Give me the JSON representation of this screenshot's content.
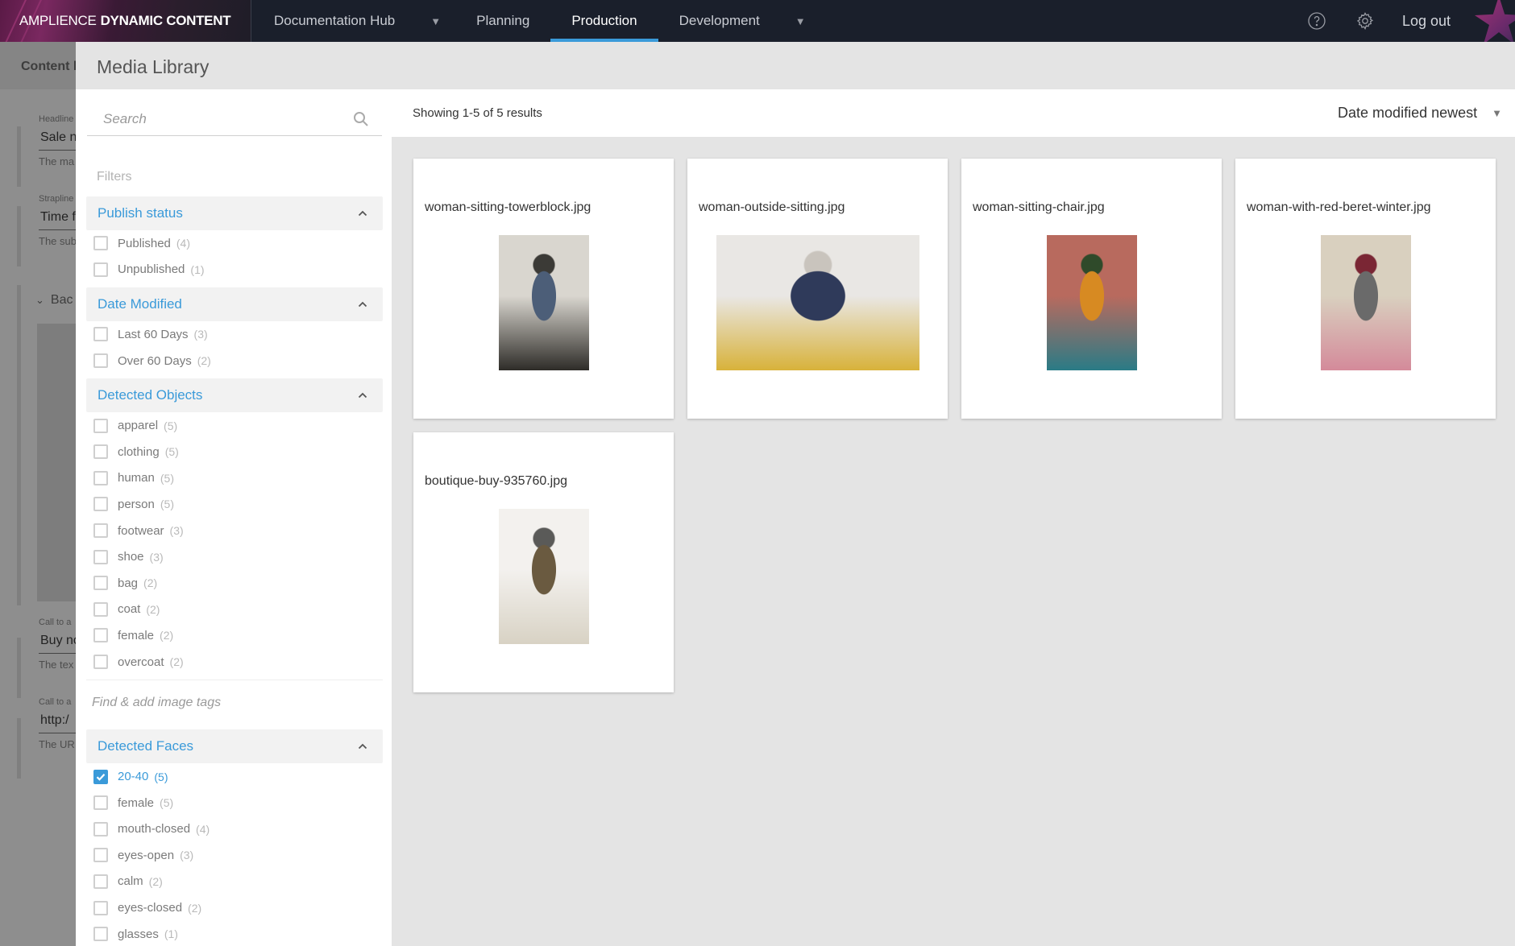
{
  "topnav": {
    "brand_light": "AMPLIENCE",
    "brand_bold": "DYNAMIC CONTENT",
    "hub": "Documentation Hub",
    "items": [
      {
        "label": "Planning",
        "active": false
      },
      {
        "label": "Production",
        "active": true
      },
      {
        "label": "Development",
        "active": false
      }
    ],
    "help_icon": "help-circle-icon",
    "settings_icon": "gear-icon",
    "logout": "Log out"
  },
  "background_page": {
    "header": "Content l",
    "fields": [
      {
        "label": "Headline",
        "value": "Sale n",
        "help": "The ma"
      },
      {
        "label": "Strapline",
        "value": "Time f",
        "help": "The sub"
      },
      {
        "label": "Call to a",
        "value": "Buy no",
        "help": "The tex"
      },
      {
        "label": "Call to a",
        "value": "http:/",
        "help": "The UR"
      }
    ],
    "section": "Bac"
  },
  "modal": {
    "title": "Media Library",
    "search": {
      "placeholder": "Search",
      "value": ""
    },
    "filters_label": "Filters",
    "filter_groups": [
      {
        "title": "Publish status",
        "items": [
          {
            "label": "Published",
            "count": "(4)",
            "checked": false
          },
          {
            "label": "Unpublished",
            "count": "(1)",
            "checked": false
          }
        ]
      },
      {
        "title": "Date Modified",
        "items": [
          {
            "label": "Last 60 Days",
            "count": "(3)",
            "checked": false
          },
          {
            "label": "Over 60 Days",
            "count": "(2)",
            "checked": false
          }
        ]
      },
      {
        "title": "Detected Objects",
        "items": [
          {
            "label": "apparel",
            "count": "(5)",
            "checked": false
          },
          {
            "label": "clothing",
            "count": "(5)",
            "checked": false
          },
          {
            "label": "human",
            "count": "(5)",
            "checked": false
          },
          {
            "label": "person",
            "count": "(5)",
            "checked": false
          },
          {
            "label": "footwear",
            "count": "(3)",
            "checked": false
          },
          {
            "label": "shoe",
            "count": "(3)",
            "checked": false
          },
          {
            "label": "bag",
            "count": "(2)",
            "checked": false
          },
          {
            "label": "coat",
            "count": "(2)",
            "checked": false
          },
          {
            "label": "female",
            "count": "(2)",
            "checked": false
          },
          {
            "label": "overcoat",
            "count": "(2)",
            "checked": false
          }
        ],
        "tag_search_placeholder": "Find & add image tags"
      },
      {
        "title": "Detected Faces",
        "items": [
          {
            "label": "20-40",
            "count": "(5)",
            "checked": true
          },
          {
            "label": "female",
            "count": "(5)",
            "checked": false
          },
          {
            "label": "mouth-closed",
            "count": "(4)",
            "checked": false
          },
          {
            "label": "eyes-open",
            "count": "(3)",
            "checked": false
          },
          {
            "label": "calm",
            "count": "(2)",
            "checked": false
          },
          {
            "label": "eyes-closed",
            "count": "(2)",
            "checked": false
          },
          {
            "label": "glasses",
            "count": "(1)",
            "checked": false
          }
        ]
      }
    ],
    "results": {
      "summary": "Showing 1-5 of 5 results",
      "sort": "Date modified newest",
      "assets": [
        {
          "name": "woman-sitting-towerblock.jpg",
          "orientation": "portrait",
          "palette": [
            "#d9d6cf",
            "#3b3a36",
            "#4c5e78",
            "#2e2c28"
          ]
        },
        {
          "name": "woman-outside-sitting.jpg",
          "orientation": "landscape",
          "palette": [
            "#e9e7e4",
            "#c9c4bd",
            "#2f3a5a",
            "#d8b23a"
          ]
        },
        {
          "name": "woman-sitting-chair.jpg",
          "orientation": "portrait",
          "palette": [
            "#b86a5e",
            "#2f4a2a",
            "#d78a22",
            "#2a7b86"
          ]
        },
        {
          "name": "woman-with-red-beret-winter.jpg",
          "orientation": "portrait",
          "palette": [
            "#d9d0bf",
            "#7a2634",
            "#6a6a6a",
            "#d48a9a"
          ]
        },
        {
          "name": "boutique-buy-935760.jpg",
          "orientation": "portrait",
          "palette": [
            "#f3f1ee",
            "#5a5a58",
            "#6a5a40",
            "#d8d2c4"
          ]
        }
      ]
    }
  },
  "colors": {
    "accent": "#3a9ad9",
    "nav_bg": "#1a1f2b"
  }
}
